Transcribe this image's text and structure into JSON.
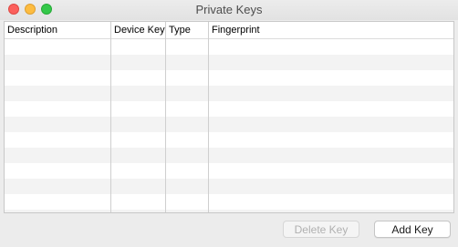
{
  "window": {
    "title": "Private Keys"
  },
  "table": {
    "columns": [
      {
        "key": "description",
        "label": "Description"
      },
      {
        "key": "device_key",
        "label": "Device Key"
      },
      {
        "key": "type",
        "label": "Type"
      },
      {
        "key": "fingerprint",
        "label": "Fingerprint"
      }
    ],
    "rows": []
  },
  "buttons": {
    "delete_label": "Delete Key",
    "delete_enabled": false,
    "add_label": "Add Key"
  },
  "colors": {
    "close": "#fc605c",
    "minimize": "#fdbc40",
    "zoom": "#34c84a"
  }
}
